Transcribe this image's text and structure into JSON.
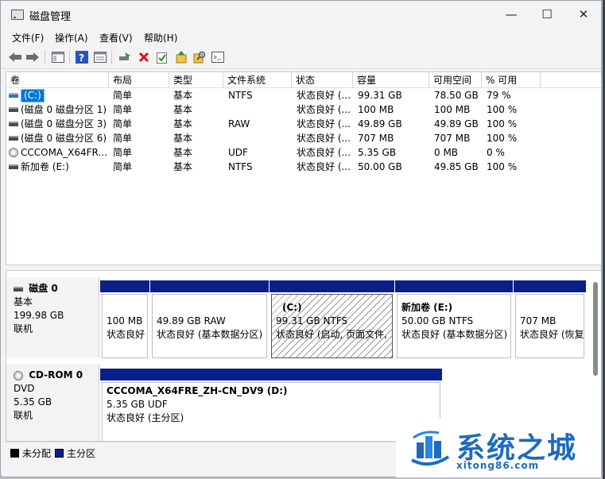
{
  "window": {
    "title": "磁盘管理",
    "minimize": "—",
    "maximize": "☐",
    "close": "✕"
  },
  "menu": [
    "文件(F)",
    "操作(A)",
    "查看(V)",
    "帮助(H)"
  ],
  "toolbar_icons": [
    "back-icon",
    "forward-icon",
    "view-icon",
    "help-icon",
    "properties-icon",
    "connect-icon",
    "delete-icon",
    "check-icon",
    "rescan-icon",
    "search-icon",
    "console-icon"
  ],
  "volume_table": {
    "columns": [
      "卷",
      "布局",
      "类型",
      "文件系统",
      "状态",
      "容量",
      "可用空间",
      "% 可用"
    ],
    "rows": [
      {
        "name": "(C:)",
        "layout": "简单",
        "type": "基本",
        "fs": "NTFS",
        "status": "状态良好 (...",
        "capacity": "99.31 GB",
        "free": "78.50 GB",
        "pct": "79 %",
        "icon": "disk-blue"
      },
      {
        "name": "(磁盘 0 磁盘分区 1)",
        "layout": "简单",
        "type": "基本",
        "fs": "",
        "status": "状态良好 (...",
        "capacity": "100 MB",
        "free": "100 MB",
        "pct": "100 %",
        "icon": "disk"
      },
      {
        "name": "(磁盘 0 磁盘分区 3)",
        "layout": "简单",
        "type": "基本",
        "fs": "RAW",
        "status": "状态良好 (...",
        "capacity": "49.89 GB",
        "free": "49.89 GB",
        "pct": "100 %",
        "icon": "disk"
      },
      {
        "name": "(磁盘 0 磁盘分区 6)",
        "layout": "简单",
        "type": "基本",
        "fs": "",
        "status": "状态良好 (...",
        "capacity": "707 MB",
        "free": "707 MB",
        "pct": "100 %",
        "icon": "disk"
      },
      {
        "name": "CCCOMA_X64FR...",
        "layout": "简单",
        "type": "基本",
        "fs": "UDF",
        "status": "状态良好 (...",
        "capacity": "5.35 GB",
        "free": "0 MB",
        "pct": "0 %",
        "icon": "cd"
      },
      {
        "name": "新加卷 (E:)",
        "layout": "简单",
        "type": "基本",
        "fs": "NTFS",
        "status": "状态良好 (...",
        "capacity": "50.00 GB",
        "free": "49.85 GB",
        "pct": "100 %",
        "icon": "disk"
      }
    ]
  },
  "disk0": {
    "name": "磁盘 0",
    "type": "基本",
    "size": "199.98 GB",
    "state": "联机",
    "partitions": [
      {
        "title": "",
        "line1": "100 MB",
        "line2": "状态良好"
      },
      {
        "title": "",
        "line1": "49.89 GB RAW",
        "line2": "状态良好 (基本数据分区)"
      },
      {
        "title": "(C:)",
        "line1": "99.31 GB NTFS",
        "line2": "状态良好 (启动, 页面文件,"
      },
      {
        "title": "新加卷  (E:)",
        "line1": "50.00 GB NTFS",
        "line2": "状态良好 (基本数据分区)"
      },
      {
        "title": "",
        "line1": "707 MB",
        "line2": "状态良好 (恢复"
      }
    ]
  },
  "cdrom0": {
    "name": "CD-ROM 0",
    "type": "DVD",
    "size": "5.35 GB",
    "state": "联机",
    "partition": {
      "title": "CCCOMA_X64FRE_ZH-CN_DV9   (D:)",
      "line1": "5.35 GB UDF",
      "line2": "状态良好 (主分区)"
    }
  },
  "legend": {
    "unallocated": "未分配",
    "primary": "主分区",
    "unallocated_color": "#000000",
    "primary_color": "#0b1f8a"
  },
  "watermark": {
    "cn": "系统之城",
    "en": "xitong86.com"
  }
}
